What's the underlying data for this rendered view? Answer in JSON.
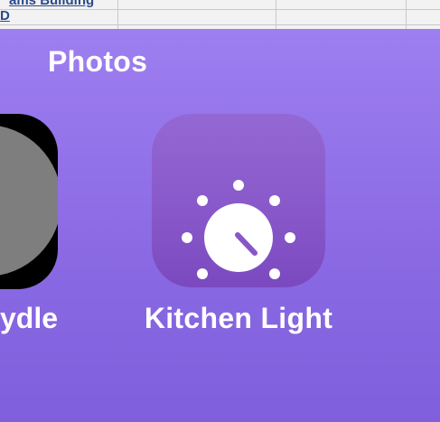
{
  "background_sheet": {
    "rows": [
      {
        "link_text": "ams Building"
      },
      {
        "link_text": "D"
      }
    ]
  },
  "panel": {
    "title": "Photos",
    "colors": {
      "panel_gradient_top": "#9e7ff0",
      "panel_gradient_bottom": "#7f5fdc",
      "app_icon_purple": "#8757c9",
      "left_app_bg": "#000000",
      "left_app_circle": "#7e7e7e"
    },
    "apps": [
      {
        "label": "ydle",
        "icon": "gray-circle-icon"
      },
      {
        "label": "Kitchen Light",
        "icon": "dimmer-knob-icon"
      }
    ]
  }
}
